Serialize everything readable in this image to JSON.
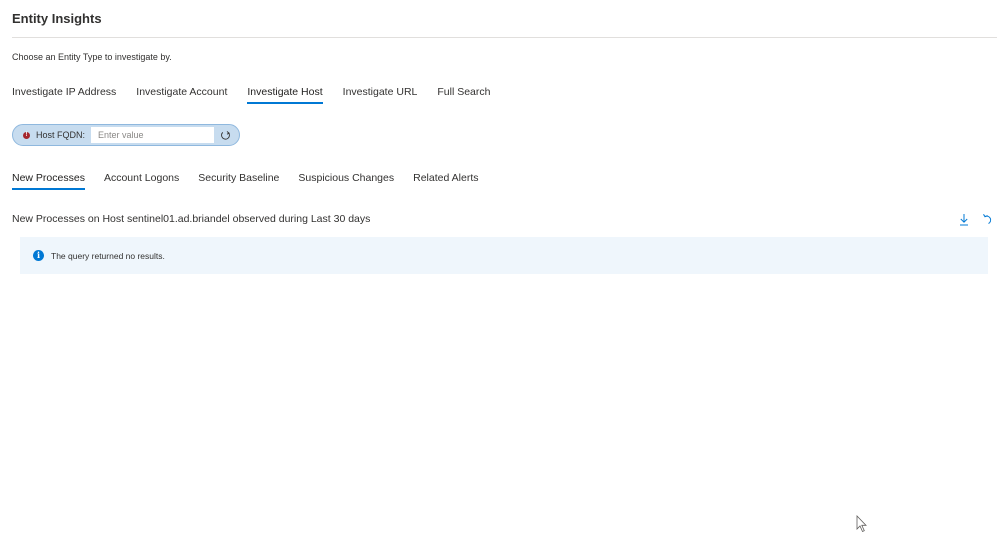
{
  "header": {
    "title": "Entity Insights"
  },
  "intro": {
    "text": "Choose an Entity Type to investigate by."
  },
  "entity_tabs": [
    {
      "label": "Investigate IP Address",
      "active": false
    },
    {
      "label": "Investigate Account",
      "active": false
    },
    {
      "label": "Investigate Host",
      "active": true
    },
    {
      "label": "Investigate URL",
      "active": false
    },
    {
      "label": "Full Search",
      "active": false
    }
  ],
  "parameter": {
    "label": "Host FQDN:",
    "value": "",
    "placeholder": "Enter value",
    "status_icon": "error-icon",
    "refresh_icon": "refresh-icon"
  },
  "sub_tabs": [
    {
      "label": "New Processes",
      "active": true
    },
    {
      "label": "Account Logons",
      "active": false
    },
    {
      "label": "Security Baseline",
      "active": false
    },
    {
      "label": "Suspicious Changes",
      "active": false
    },
    {
      "label": "Related Alerts",
      "active": false
    }
  ],
  "section": {
    "title": "New Processes on Host sentinel01.ad.briandel observed during Last 30 days",
    "actions": [
      "download-icon",
      "undo-icon"
    ]
  },
  "message": {
    "icon": "info-icon",
    "text": "The query returned no results."
  },
  "colors": {
    "accent": "#0078d4",
    "error": "#a4262c",
    "pill_background": "#c7dcef",
    "message_background": "#eff6fc"
  }
}
